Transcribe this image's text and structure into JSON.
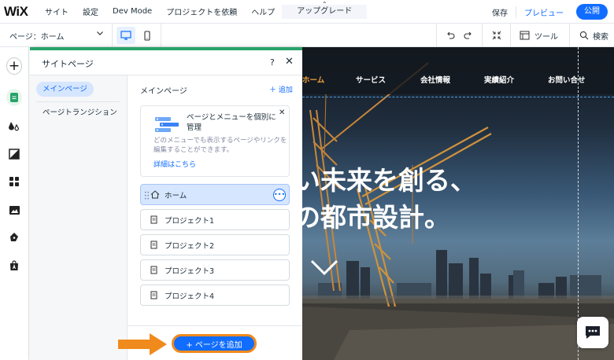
{
  "topbar": {
    "logo": "WiX",
    "menu": [
      "サイト",
      "設定",
      "Dev Mode",
      "プロジェクトを依頼",
      "ヘルプ"
    ],
    "upgrade": "アップグレード",
    "save": "保存",
    "preview": "プレビュー",
    "publish": "公開"
  },
  "subbar": {
    "page_select": "ページ：ホーム",
    "tools": "ツール",
    "search": "検索"
  },
  "panel": {
    "title": "サイトページ",
    "help": "?",
    "close": "✕",
    "side_active": "メインページ",
    "side_item": "ページトランジション",
    "main_title": "メインページ",
    "main_add": "＋ 追加",
    "info": {
      "title": "ページとメニューを個別に管理",
      "desc": "どのメニューでも表示するページやリンクを編集することができます。",
      "link": "詳細はこちら",
      "close": "✕"
    },
    "pages": [
      {
        "label": "ホーム",
        "icon": "home-icon",
        "selected": true
      },
      {
        "label": "プロジェクト1",
        "icon": "page-icon"
      },
      {
        "label": "プロジェクト2",
        "icon": "page-icon"
      },
      {
        "label": "プロジェクト3",
        "icon": "page-icon"
      },
      {
        "label": "プロジェクト4",
        "icon": "page-icon"
      }
    ],
    "add_page": "+ ページを追加"
  },
  "canvas": {
    "nav": [
      "ホーム",
      "サービス",
      "会社情報",
      "実績紹介",
      "お問い合せ"
    ],
    "hero_line1": "い未来を創る、",
    "hero_line2": "の都市設計。"
  },
  "colors": {
    "accent_blue": "#116dff",
    "panel_green": "#29a36a",
    "upgrade_purple": "#9a27d5",
    "highlight_orange": "#f08a1c"
  }
}
